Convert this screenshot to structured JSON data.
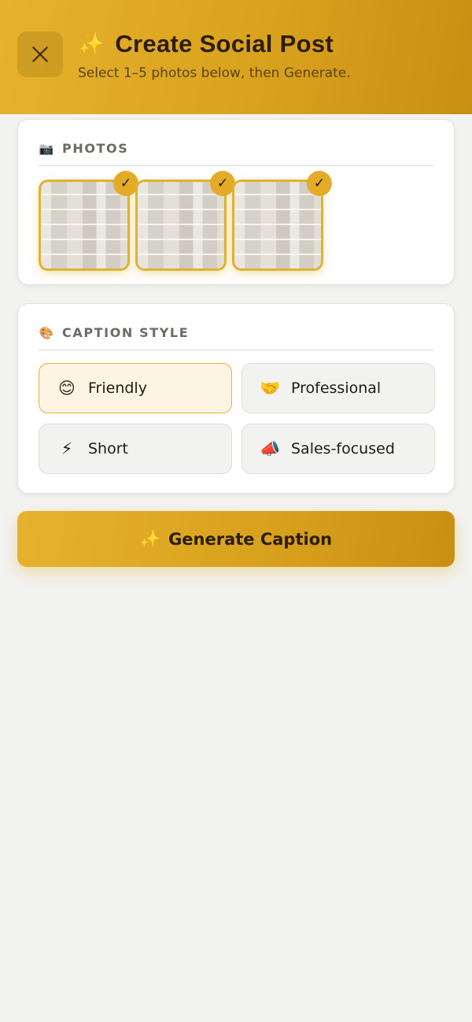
{
  "header": {
    "close_icon": "close-icon",
    "title_icon": "✨",
    "title": "Create Social Post",
    "subtitle": "Select 1–5 photos below, then Generate."
  },
  "photos_section": {
    "icon": "📷",
    "label": "PHOTOS",
    "items": [
      {
        "selected": true,
        "check": "✓"
      },
      {
        "selected": true,
        "check": "✓"
      },
      {
        "selected": true,
        "check": "✓"
      }
    ]
  },
  "caption_style_section": {
    "icon": "🎨",
    "label": "CAPTION STYLE",
    "options": [
      {
        "emoji": "😊",
        "label": "Friendly",
        "selected": true
      },
      {
        "emoji": "🤝",
        "label": "Professional",
        "selected": false
      },
      {
        "emoji": "⚡",
        "label": "Short",
        "selected": false
      },
      {
        "emoji": "📣",
        "label": "Sales-focused",
        "selected": false
      }
    ]
  },
  "generate_button": {
    "icon": "✨",
    "label": "Generate Caption"
  },
  "colors": {
    "accent": "#e3b12f",
    "accent_dark": "#c98f12",
    "selected_bg": "#fdf4e3",
    "page_bg": "#f2f2f0"
  }
}
